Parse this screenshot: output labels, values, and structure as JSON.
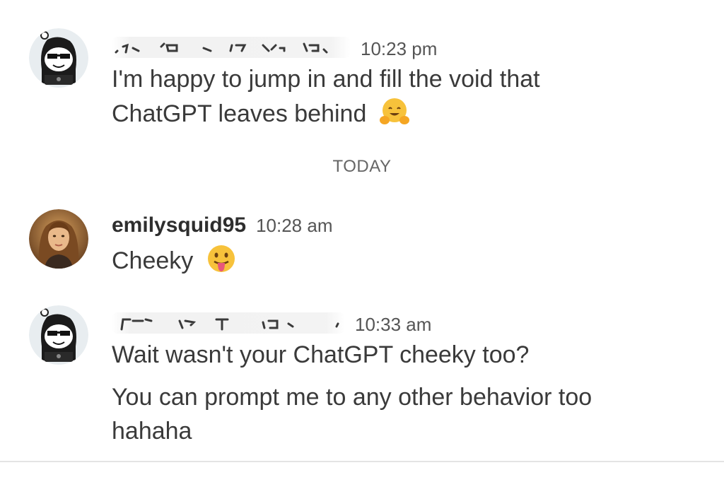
{
  "chat": {
    "day_separator": "TODAY",
    "messages": [
      {
        "username": "",
        "username_redacted": true,
        "timestamp": "10:23 pm",
        "lines": [
          "I'm happy to jump in and fill the void that",
          "ChatGPT leaves behind"
        ],
        "emoji": "hugging-face-emoji"
      },
      {
        "username": "emilysquid95",
        "username_redacted": false,
        "timestamp": "10:28 am",
        "lines": [
          "Cheeky"
        ],
        "emoji": "tongue-out-emoji"
      },
      {
        "username": "",
        "username_redacted": true,
        "timestamp": "10:33 am",
        "lines": [
          "Wait wasn't your ChatGPT cheeky too?",
          "You can prompt me to any other behavior too",
          "hahaha"
        ],
        "emoji": ""
      }
    ]
  },
  "colors": {
    "text": "#3a3a3a",
    "timestamp": "#555555",
    "separator": "#666666",
    "divider": "#e4e4e4",
    "emoji_yellow": "#f7c23b"
  }
}
